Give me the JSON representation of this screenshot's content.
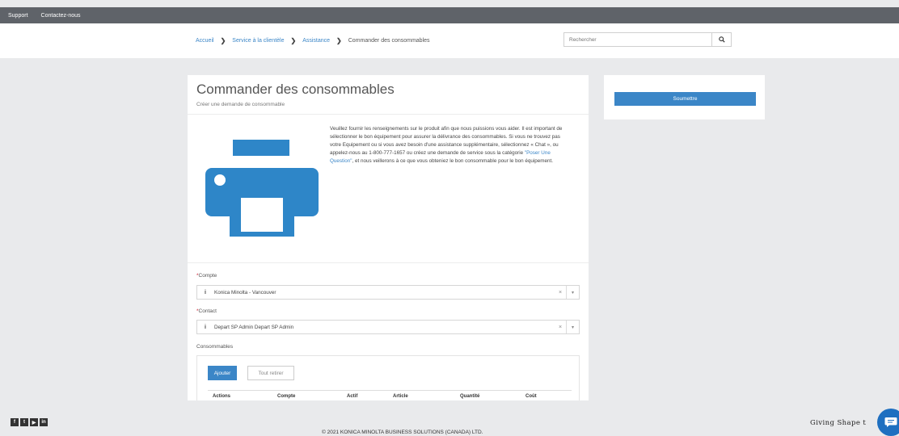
{
  "topbar": {
    "support": "Support",
    "contact": "Contactez-nous"
  },
  "breadcrumb": {
    "home": "Accueil",
    "service": "Service à la clientèle",
    "assistance": "Assistance",
    "current": "Commander des consommables",
    "separator": "❯"
  },
  "search": {
    "placeholder": "Rechercher"
  },
  "main": {
    "title": "Commander des consommables",
    "subtitle": "Créer une demande de consommable",
    "description_before": "Veuillez fournir les renseignements sur le produit afin que nous puissions vous aider. Il est important de sélectionner le bon équipement pour assurer la délivrance des consommables. Si vous ne trouvez pas votre Equipement ou si vous avez besoin d'une assistance supplémentaire, sélectionnez « Chat », ou appelez-nous au 1-800-777-1657 ou créez une demande de service sous la catégorie",
    "description_link": "\"Poser Une Question\"",
    "description_after": ", et nous veillerons à ce que vous obteniez le bon consommable pour le bon équipement.",
    "printer_color": "#2e86c8"
  },
  "form": {
    "required_mark": "*",
    "account_label": "Compte",
    "account_value": "Konica Minolta - Vancouver",
    "contact_label": "Contact",
    "contact_value": "Depart SP Admin Depart SP Admin",
    "info_icon": "i",
    "clear_icon": "×",
    "caret_icon": "▾",
    "consumables_label": "Consommables",
    "add_button": "Ajouter",
    "clear_all_button": "Tout retirer",
    "columns": [
      "Actions",
      "Compte",
      "Actif",
      "Article",
      "Quantité",
      "Coût"
    ]
  },
  "sidebar": {
    "submit": "Soumettre"
  },
  "footer": {
    "social": [
      "f",
      "t",
      "▶",
      "in"
    ],
    "copyright": "© 2021 KONICA MINOLTA BUSINESS SOLUTIONS (CANADA) LTD.",
    "slogan": "Giving Shape t"
  },
  "colors": {
    "accent": "#3b86c7",
    "topbar": "#5f6369",
    "background": "#e9eaec"
  }
}
